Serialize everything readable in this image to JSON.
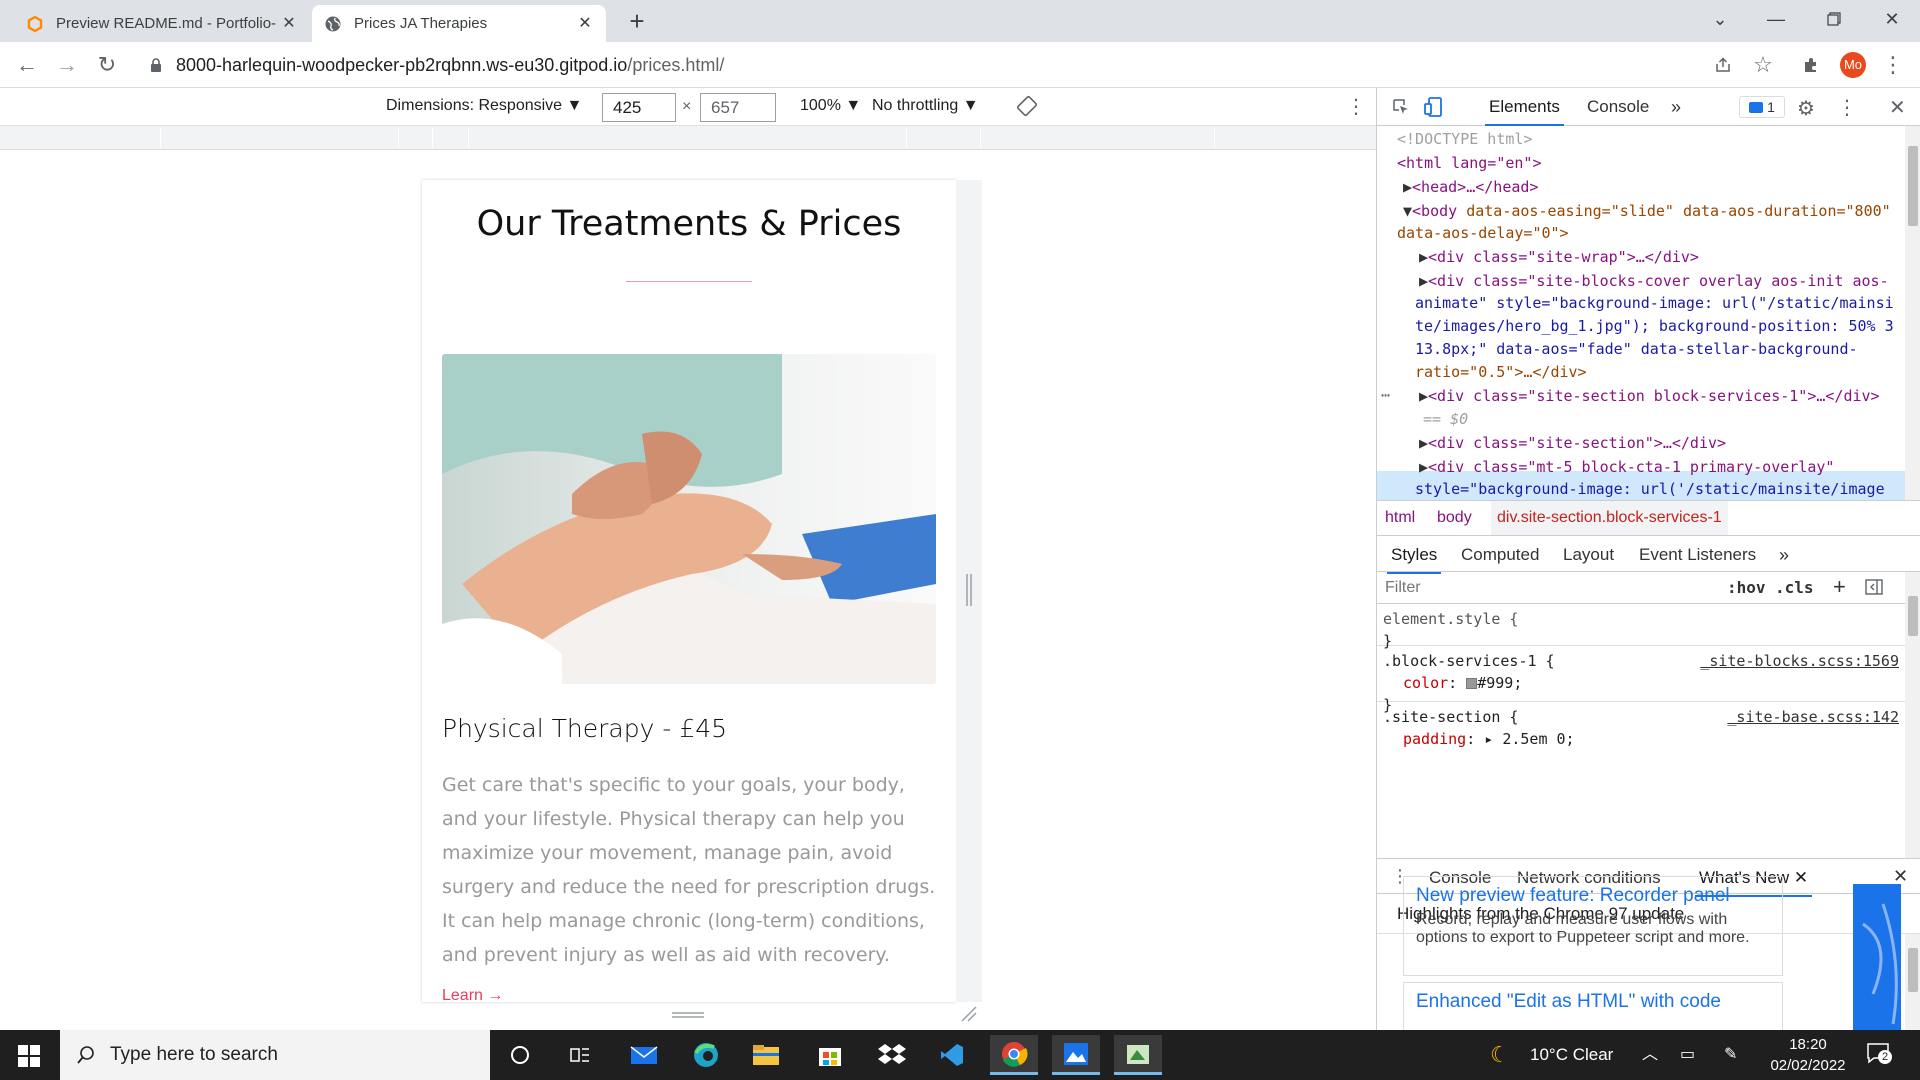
{
  "browser": {
    "tabs": [
      {
        "title": "Preview README.md - Portfolio-",
        "active": false,
        "favicon": "gitpod-icon"
      },
      {
        "title": "Prices JA Therapies",
        "active": true,
        "favicon": "globe-icon"
      }
    ],
    "new_tab_label": "+",
    "url_host": "8000-harlequin-woodpecker-pb2rqbnn.ws-eu30.gitpod.io",
    "url_path": "/prices.html/",
    "profile_label": "Mo"
  },
  "device_toolbar": {
    "dimensions_label": "Dimensions: Responsive ▼",
    "width": "425",
    "times": "×",
    "height": "657",
    "zoom": "100% ▼",
    "throttling": "No throttling ▼"
  },
  "page": {
    "heading": "Our Treatments & Prices",
    "treatment_title": "Physical Therapy - £45",
    "treatment_desc": "Get care that's specific to your goals, your body, and your lifestyle. Physical therapy can help you maximize your movement, manage pain, avoid surgery and reduce the need for prescription drugs. It can help manage chronic (long-term) conditions, and prevent injury as well as aid with recovery.",
    "learn_more": "Learn →",
    "accent_color": "#e89ab7"
  },
  "devtools": {
    "tabs": [
      "Elements",
      "Console",
      "»"
    ],
    "issues_count": "1",
    "dom": {
      "doctype": "<!DOCTYPE html>",
      "html_open": "<html lang=\"en\">",
      "head": "<head>…</head>",
      "body_tag": "<body",
      "body_attrs_1": " data-aos-easing=\"slide\" data-aos-duration=\"800\"",
      "body_attrs_2": "data-aos-delay=\"0\">",
      "site_wrap": "<div class=\"site-wrap\">…</div>",
      "cover_1": "<div class=\"site-blocks-cover overlay aos-init aos-",
      "cover_2": "animate\" style=\"background-image: url(\"/static/mainsi",
      "cover_3": "te/images/hero_bg_1.jpg\"); background-position: 50% 3",
      "cover_4": "13.8px;\" data-aos=\"fade\" data-stellar-background-",
      "cover_5": "ratio=\"0.5\">…</div>",
      "selected_1": "<div class=\"site-section block-services-1\">…</div>",
      "selected_2": "== $0",
      "site_section": "<div class=\"site-section\">…</div>",
      "cta_1": "<div class=\"mt-5 block-cta-1 primary-overlay\"",
      "cta_2": "style=\"background-image: url('/static/mainsite/image"
    },
    "breadcrumbs": [
      "html",
      "body",
      "div.site-section.block-services-1"
    ],
    "styles_tabs": [
      "Styles",
      "Computed",
      "Layout",
      "Event Listeners",
      "»"
    ],
    "filter_placeholder": "Filter",
    "hov": ":hov",
    "cls": ".cls",
    "rules": {
      "element_style": "element.style {",
      "close": "}",
      "r1_selector": ".block-services-1 {",
      "r1_source": "_site-blocks.scss:1569",
      "r1_prop": "color",
      "r1_value": "#999;",
      "r2_selector": ".site-section {",
      "r2_source": "_site-base.scss:142",
      "r2_prop": "padding",
      "r2_value": "▸ 2.5em 0;"
    },
    "drawer_tabs": [
      "Console",
      "Network conditions",
      "What's New"
    ],
    "drawer_heading": "Highlights from the Chrome 97 update",
    "whats_new": [
      {
        "title": "New preview feature: Recorder panel",
        "desc": "Record, replay and measure user flows with options to export to Puppeteer script and more."
      },
      {
        "title": "Enhanced \"Edit as HTML\" with code",
        "desc": ""
      }
    ]
  },
  "taskbar": {
    "search_placeholder": "Type here to search",
    "weather": "10°C  Clear",
    "time": "18:20",
    "date": "02/02/2022",
    "notifications": "2"
  }
}
